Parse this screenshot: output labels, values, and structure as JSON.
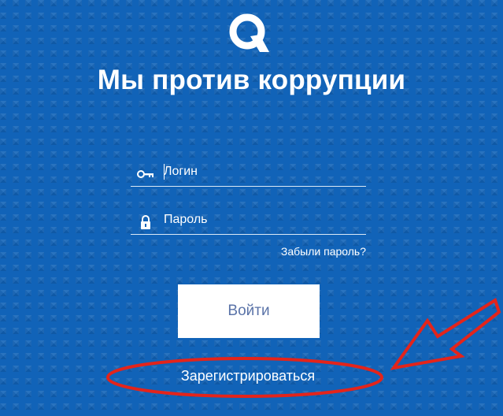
{
  "header": {
    "logo_icon": "q-logo-icon",
    "title": "Мы против коррупции"
  },
  "form": {
    "login": {
      "icon": "key-icon",
      "placeholder": "Логин",
      "value": ""
    },
    "password": {
      "icon": "lock-icon",
      "placeholder": "Пароль",
      "value": ""
    },
    "forgot_password_label": "Забыли пароль?",
    "submit_label": "Войти",
    "register_label": "Зарегистрироваться"
  },
  "annotation": {
    "shapes": [
      "red-ellipse-highlight",
      "red-arrow"
    ],
    "color": "#e3241b"
  },
  "colors": {
    "background": "#1163b8",
    "button_background": "#ffffff",
    "button_text": "#5a73a8",
    "text": "#ffffff"
  }
}
